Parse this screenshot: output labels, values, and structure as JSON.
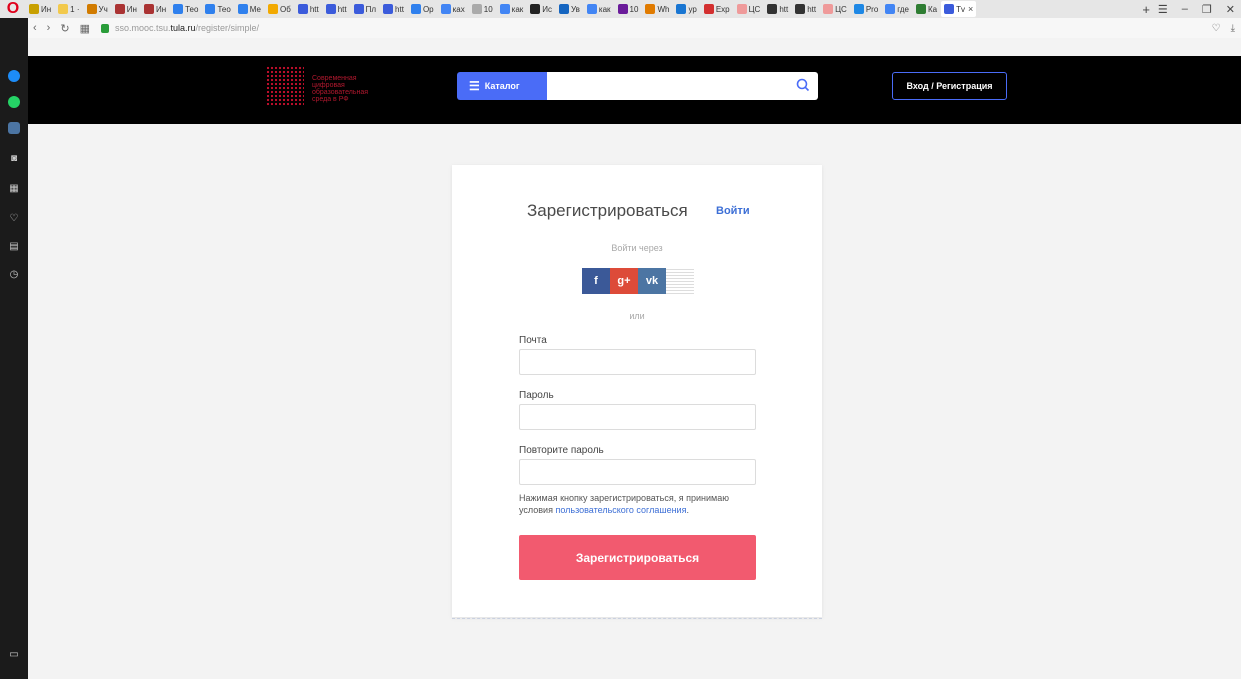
{
  "browser": {
    "tabs": [
      {
        "label": "Ин",
        "color": "#c8a000"
      },
      {
        "label": "1 ·",
        "color": "#f2c94c"
      },
      {
        "label": "Уч",
        "color": "#d17b00"
      },
      {
        "label": "Ин",
        "color": "#a33"
      },
      {
        "label": "Ин",
        "color": "#a33"
      },
      {
        "label": "Тео",
        "color": "#2f80ed"
      },
      {
        "label": "Тео",
        "color": "#2f80ed"
      },
      {
        "label": "Ме",
        "color": "#2f80ed"
      },
      {
        "label": "Об",
        "color": "#f2a900"
      },
      {
        "label": "htt",
        "color": "#3b5bdb"
      },
      {
        "label": "htt",
        "color": "#3b5bdb"
      },
      {
        "label": "Пл",
        "color": "#3b5bdb"
      },
      {
        "label": "htt",
        "color": "#3b5bdb"
      },
      {
        "label": "Op",
        "color": "#2f80ed"
      },
      {
        "label": "ках",
        "color": "#4285f4"
      },
      {
        "label": "10",
        "color": "#aaa"
      },
      {
        "label": "как",
        "color": "#4285f4"
      },
      {
        "label": "Ис",
        "color": "#222"
      },
      {
        "label": "Ув",
        "color": "#1565c0"
      },
      {
        "label": "как",
        "color": "#4285f4"
      },
      {
        "label": "10",
        "color": "#6a1b9a"
      },
      {
        "label": "Wh",
        "color": "#e07b00"
      },
      {
        "label": "ур",
        "color": "#1976d2"
      },
      {
        "label": "Exp",
        "color": "#d32f2f"
      },
      {
        "label": "ЦС",
        "color": "#ef9a9a"
      },
      {
        "label": "htt",
        "color": "#333"
      },
      {
        "label": "htt",
        "color": "#333"
      },
      {
        "label": "ЦС",
        "color": "#ef9a9a"
      },
      {
        "label": "Pro",
        "color": "#1e88e5"
      },
      {
        "label": "где",
        "color": "#4285f4"
      },
      {
        "label": "Ка",
        "color": "#2e7d32"
      },
      {
        "label": "Tv",
        "color": "#3b5bdb",
        "active": true
      }
    ],
    "new_tab": "+",
    "close_tab": "×",
    "url_prefix": "sso.mooc.tsu.",
    "url_host": "tula.ru",
    "url_path": "/register/simple/"
  },
  "header": {
    "logo_line1": "Современная",
    "logo_line2": "цифровая",
    "logo_line3": "образовательная",
    "logo_line4": "среда в РФ",
    "catalog_label": "Каталог",
    "search_placeholder": "",
    "login_label": "Вход / Регистрация"
  },
  "form": {
    "title": "Зарегистрироваться",
    "login_link": "Войти",
    "via_label": "Войти через",
    "social": [
      {
        "name": "facebook",
        "glyph": "f"
      },
      {
        "name": "google-plus",
        "glyph": "g+"
      },
      {
        "name": "vk",
        "glyph": "vk"
      }
    ],
    "or_label": "или",
    "email_label": "Почта",
    "email_value": "",
    "password_label": "Пароль",
    "password_value": "",
    "repeat_label": "Повторите пароль",
    "repeat_value": "",
    "agree_text": "Нажимая кнопку зарегистрироваться, я принимаю условия ",
    "agree_link": "пользовательского соглашения",
    "agree_end": ".",
    "submit_label": "Зарегистрироваться"
  }
}
